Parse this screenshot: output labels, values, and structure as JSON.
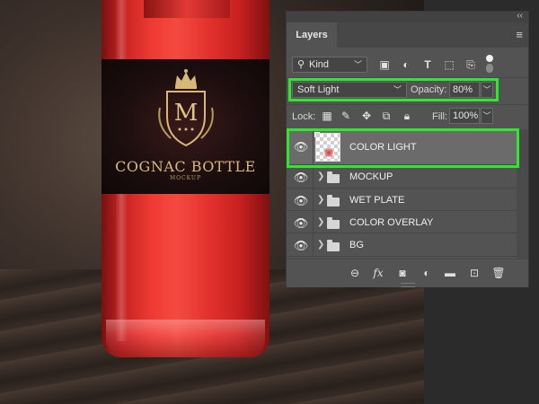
{
  "canvas": {
    "brand_name": "COGNAC BOTTLE",
    "brand_sub": "MOCKUP",
    "monogram": "M"
  },
  "panel": {
    "collapse_glyph": "‹‹",
    "tab_label": "Layers",
    "menu_glyph": "≡",
    "filter": {
      "kind_label": "Kind",
      "icons": [
        "image-filter-icon",
        "adjustment-filter-icon",
        "type-filter-icon",
        "shape-filter-icon",
        "smart-object-filter-icon"
      ]
    },
    "blend": {
      "mode": "Soft Light",
      "opacity_label": "Opacity:",
      "opacity_value": "80%"
    },
    "lock": {
      "label": "Lock:",
      "fill_label": "Fill:",
      "fill_value": "100%"
    },
    "layers": [
      {
        "name": "COLOR LIGHT",
        "type": "layer",
        "selected": true
      },
      {
        "name": "MOCKUP",
        "type": "group"
      },
      {
        "name": "WET PLATE",
        "type": "group"
      },
      {
        "name": "COLOR OVERLAY",
        "type": "group"
      },
      {
        "name": "BG",
        "type": "group"
      }
    ],
    "footer_icons": [
      "link-layers-icon",
      "fx-icon",
      "add-mask-icon",
      "adjustment-layer-icon",
      "new-group-icon",
      "new-layer-icon",
      "delete-icon"
    ]
  },
  "highlight_color": "#2ee82e"
}
